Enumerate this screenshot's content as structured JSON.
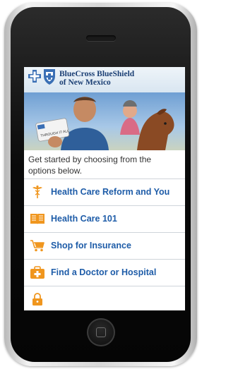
{
  "brand": {
    "name_line1": "BlueCross BlueShield",
    "name_line2": "of New Mexico",
    "hero_card_text": "THROUGH IT ALL"
  },
  "intro": {
    "text": "Get started by choosing from the options below."
  },
  "menu": {
    "items": [
      {
        "label": "Health Care Reform and You",
        "icon": "caduceus-icon"
      },
      {
        "label": "Health Care 101",
        "icon": "book-icon"
      },
      {
        "label": "Shop for Insurance",
        "icon": "shopping-cart-icon"
      },
      {
        "label": "Find a Doctor or Hospital",
        "icon": "first-aid-kit-icon"
      },
      {
        "label": "",
        "icon": "lock-icon"
      }
    ]
  },
  "colors": {
    "brand_blue": "#1b3f74",
    "link_blue": "#1e5ca8",
    "icon_orange": "#f0961e"
  }
}
